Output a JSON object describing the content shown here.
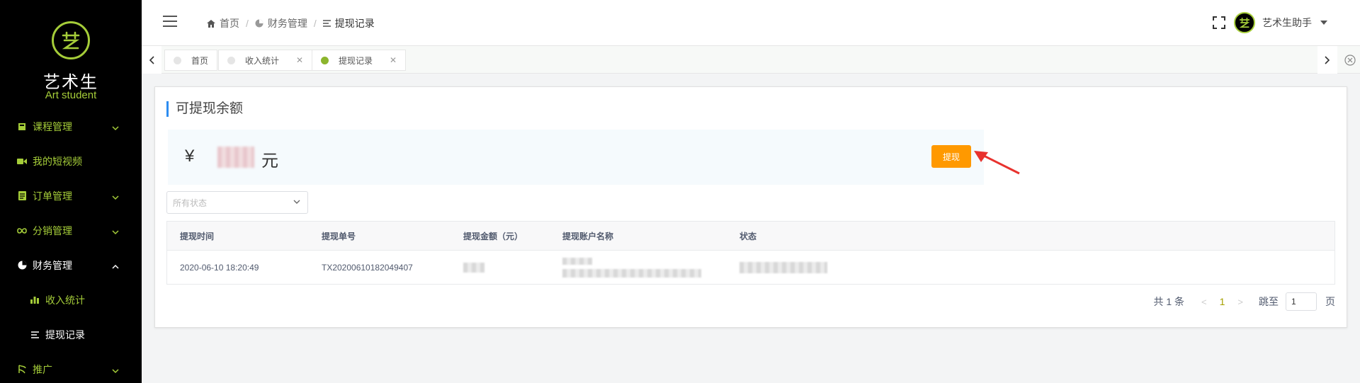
{
  "sidebar": {
    "logo_name": "艺术生",
    "logo_en": "Art student",
    "items": [
      {
        "label": "课程管理",
        "icon": "book-icon",
        "has_arrow": true
      },
      {
        "label": "我的短视频",
        "icon": "video-icon",
        "has_arrow": false
      },
      {
        "label": "订单管理",
        "icon": "order-icon",
        "has_arrow": true
      },
      {
        "label": "分销管理",
        "icon": "infinity-icon",
        "has_arrow": true
      },
      {
        "label": "财务管理",
        "icon": "pie-chart-icon",
        "has_arrow": true,
        "expanded": true
      },
      {
        "label": "收入统计",
        "icon": "bar-chart-icon",
        "sub": true
      },
      {
        "label": "提现记录",
        "icon": "list-icon",
        "sub": true,
        "current": true
      },
      {
        "label": "推广",
        "icon": "promote-icon",
        "has_arrow": true
      }
    ]
  },
  "header": {
    "breadcrumb": [
      "首页",
      "财务管理",
      "提现记录"
    ],
    "username": "艺术生助手"
  },
  "tabs": [
    {
      "label": "首页",
      "active": false,
      "closable": false
    },
    {
      "label": "收入统计",
      "active": false,
      "closable": true
    },
    {
      "label": "提现记录",
      "active": true,
      "closable": true
    }
  ],
  "card": {
    "title": "可提现余额",
    "currency_symbol": "¥",
    "unit": "元",
    "withdraw_label": "提现"
  },
  "filter": {
    "placeholder": "所有状态"
  },
  "table": {
    "columns": [
      "提现时间",
      "提现单号",
      "提现金额（元）",
      "提现账户名称",
      "状态"
    ],
    "rows": [
      {
        "time": "2020-06-10 18:20:49",
        "order_no": "TX20200610182049407"
      }
    ]
  },
  "pagination": {
    "total_text": "共 1 条",
    "current_page": "1",
    "jump_label": "跳至",
    "jump_value": "1",
    "page_suffix": "页"
  },
  "colors": {
    "brand": "#a5cd39",
    "sidebar_bg": "#000000",
    "accent_button": "#ff9900",
    "title_bar": "#2d8cf0"
  }
}
